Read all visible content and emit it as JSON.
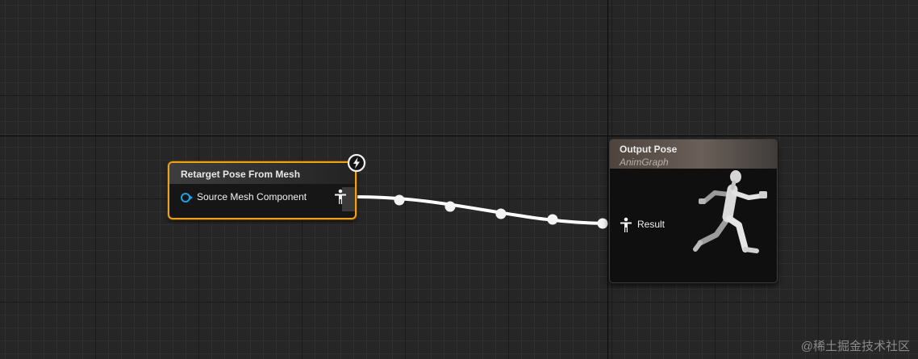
{
  "retarget_node": {
    "title": "Retarget Pose From Mesh",
    "input_label": "Source Mesh Component",
    "accent": "#f0a11c",
    "input_pin_color": "#1ea0e8"
  },
  "output_node": {
    "title": "Output Pose",
    "subtitle": "AnimGraph",
    "result_label": "Result"
  },
  "watermark": "@稀土掘金技术社区",
  "icons": {
    "lightning": "lightning-bolt-icon",
    "pose": "pose-person-icon",
    "mannequin": "running-mannequin"
  }
}
